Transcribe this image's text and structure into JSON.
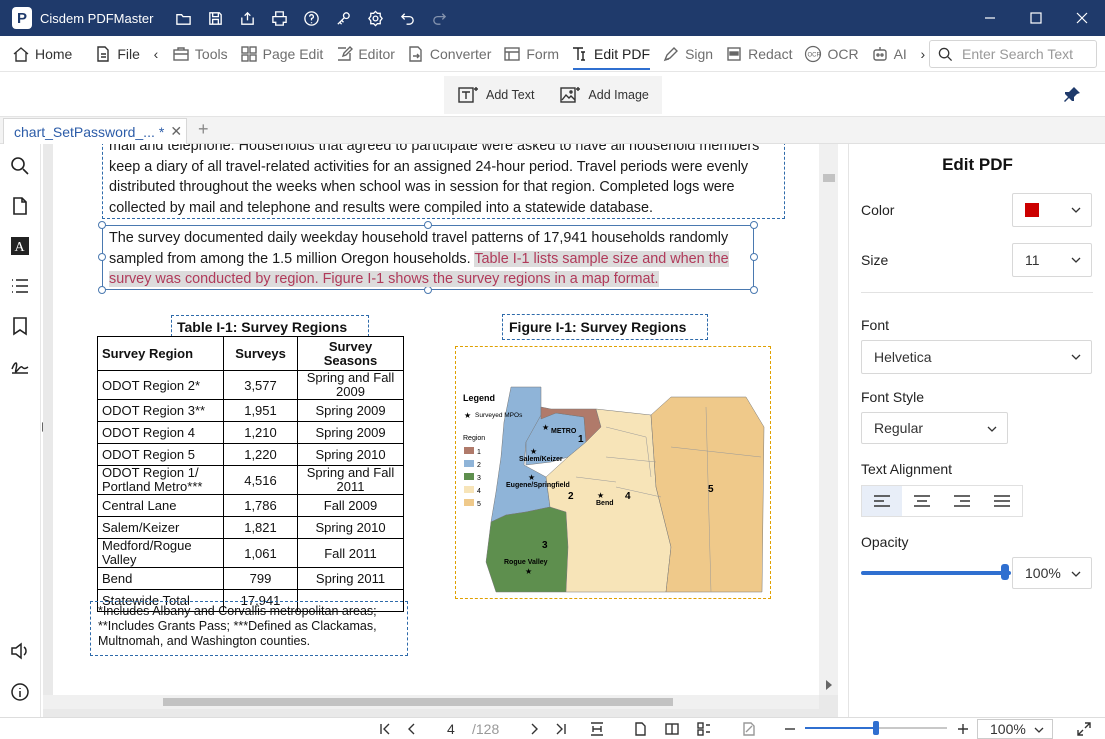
{
  "app": {
    "title": "Cisdem PDFMaster"
  },
  "menu": {
    "home": "Home",
    "file": "File",
    "tools": "Tools",
    "page_edit": "Page Edit",
    "editor": "Editor",
    "converter": "Converter",
    "form": "Form",
    "edit_pdf": "Edit PDF",
    "sign": "Sign",
    "redact": "Redact",
    "ocr": "OCR",
    "ai": "AI",
    "search_placeholder": "Enter Search Text"
  },
  "subtoolbar": {
    "add_text": "Add Text",
    "add_image": "Add Image"
  },
  "tab": {
    "name": "chart_SetPassword_...",
    "modified": "*",
    "close": "✕",
    "new": "+"
  },
  "document": {
    "para1": "mail and telephone. Households that agreed to participate were asked to have all household members keep a diary of all travel-related activities for an assigned 24-hour period. Travel periods were evenly distributed throughout the weeks when school was in session for that region. Completed logs were collected by mail and telephone and results were compiled into a statewide database.",
    "para2_a": "The survey documented daily weekday household travel patterns of 17,941 households randomly sampled from among the 1.5 million Oregon households. ",
    "para2_b": "Table I-1 lists sample size and when the survey was conducted by region. Figure I-1 shows the survey regions in a map format.",
    "table_caption": "Table I-1:  Survey Regions",
    "figure_caption": "Figure I-1:  Survey Regions",
    "table": {
      "headers": [
        "Survey Region",
        "Surveys",
        "Survey Seasons"
      ],
      "rows": [
        [
          "ODOT Region 2*",
          "3,577",
          "Spring and Fall 2009"
        ],
        [
          "ODOT Region 3**",
          "1,951",
          "Spring 2009"
        ],
        [
          "ODOT Region 4",
          "1,210",
          "Spring 2009"
        ],
        [
          "ODOT Region 5",
          "1,220",
          "Spring 2010"
        ],
        [
          "ODOT Region 1/ Portland Metro***",
          "4,516",
          "Spring and Fall 2011"
        ],
        [
          "Central Lane",
          "1,786",
          "Fall 2009"
        ],
        [
          "Salem/Keizer",
          "1,821",
          "Spring 2010"
        ],
        [
          "Medford/Rogue Valley",
          "1,061",
          "Fall 2011"
        ],
        [
          "Bend",
          "799",
          "Spring 2011"
        ],
        [
          "Statewide Total",
          "17,941",
          ""
        ]
      ]
    },
    "footnote": "*Includes Albany and Corvallis metropolitan areas; **Includes Grants Pass; ***Defined as Clackamas, Multnomah, and Washington counties.",
    "map": {
      "legend_title": "Legend",
      "mpo_label": "Surveyed MPOs",
      "region_label": "Region",
      "legend_items": [
        "1",
        "2",
        "3",
        "4",
        "5"
      ],
      "legend_colors": [
        "#b07a6a",
        "#8fb4d8",
        "#5e8f4e",
        "#f7e4b8",
        "#efc98a"
      ],
      "labels": {
        "metro": "METRO",
        "salem": "Salem/Keizer",
        "eugene": "Eugene/Springfield",
        "bend": "Bend",
        "rogue": "Rogue Valley"
      },
      "region_numbers": [
        "1",
        "2",
        "3",
        "4",
        "5"
      ]
    }
  },
  "navigation": {
    "page": "4",
    "total": "/128",
    "zoom": "100%"
  },
  "panel": {
    "title": "Edit PDF",
    "color_label": "Color",
    "color_value": "#cc0000",
    "size_label": "Size",
    "size_value": "11",
    "font_label": "Font",
    "font_value": "Helvetica",
    "style_label": "Font Style",
    "style_value": "Regular",
    "align_label": "Text Alignment",
    "opacity_label": "Opacity",
    "opacity_value": "100%"
  }
}
